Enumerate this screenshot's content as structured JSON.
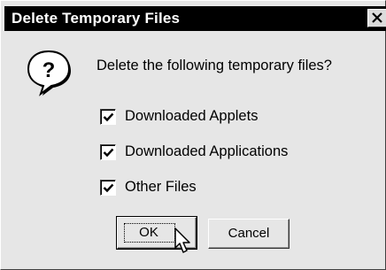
{
  "dialog": {
    "title": "Delete Temporary Files",
    "prompt": "Delete the following temporary files?",
    "options": [
      {
        "label": "Downloaded Applets",
        "checked": true
      },
      {
        "label": "Downloaded Applications",
        "checked": true
      },
      {
        "label": "Other Files",
        "checked": true
      }
    ],
    "buttons": {
      "ok": "OK",
      "cancel": "Cancel"
    }
  },
  "icons": {
    "close": "close-icon",
    "question": "question-icon",
    "checkmark": "checkmark-icon",
    "cursor": "mouse-cursor-icon"
  },
  "colors": {
    "titlebar": "#000000",
    "title_text": "#ffffff",
    "dialog_bg": "#e6e6e6"
  }
}
